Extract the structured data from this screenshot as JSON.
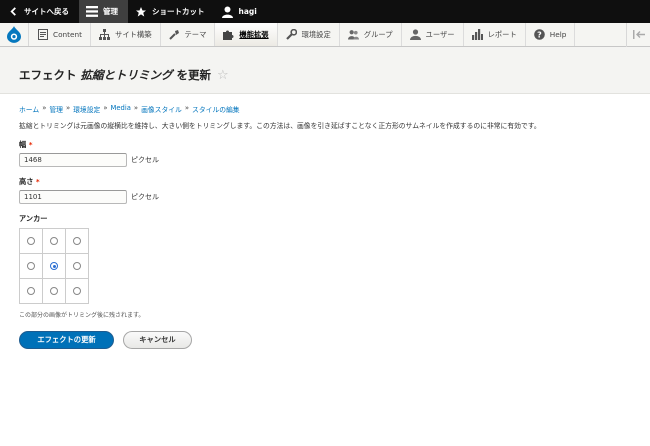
{
  "topbar": {
    "back_label": "サイトへ戻る",
    "manage_label": "管理",
    "shortcuts_label": "ショートカット",
    "user_label": "hagi"
  },
  "tray": {
    "items": [
      {
        "label": "Content",
        "icon": "content-icon"
      },
      {
        "label": "サイト構築",
        "icon": "structure-icon"
      },
      {
        "label": "テーマ",
        "icon": "appearance-icon"
      },
      {
        "label": "機能拡張",
        "icon": "extend-icon"
      },
      {
        "label": "環境設定",
        "icon": "config-icon"
      },
      {
        "label": "グループ",
        "icon": "group-icon"
      },
      {
        "label": "ユーザー",
        "icon": "people-icon"
      },
      {
        "label": "レポート",
        "icon": "reports-icon"
      },
      {
        "label": "Help",
        "icon": "help-icon"
      }
    ]
  },
  "page": {
    "title_prefix": "エフェクト",
    "title_name": "拡縮とトリミング",
    "title_suffix": "を更新"
  },
  "breadcrumb": [
    "ホーム",
    "管理",
    "環境設定",
    "Media",
    "画像スタイル",
    "スタイルの編集"
  ],
  "breadcrumb_sep": "»",
  "description": "拡縮とトリミングは元画像の縦横比を維持し、大きい側をトリミングします。この方法は、画像を引き延ばすことなく正方形のサムネイルを作成するのに非常に有効です。",
  "form": {
    "width_label": "幅",
    "width_value": "1468",
    "width_unit": "ピクセル",
    "height_label": "高さ",
    "height_value": "1101",
    "height_unit": "ピクセル",
    "required_mark": "*",
    "anchor_label": "アンカー",
    "anchor_selected": "center-center",
    "anchor_help": "この部分の画像がトリミング後に残されます。",
    "submit_label": "エフェクトの更新",
    "cancel_label": "キャンセル"
  },
  "colors": {
    "primary_button": "#0071b8",
    "link": "#0074bd",
    "required": "#e62600"
  }
}
